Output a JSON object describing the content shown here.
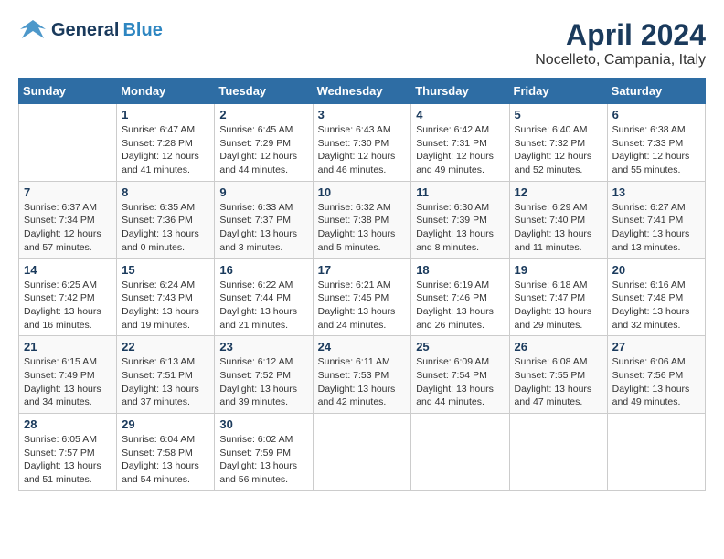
{
  "logo": {
    "text_general": "General",
    "text_blue": "Blue"
  },
  "title": "April 2024",
  "subtitle": "Nocelleto, Campania, Italy",
  "days_of_week": [
    "Sunday",
    "Monday",
    "Tuesday",
    "Wednesday",
    "Thursday",
    "Friday",
    "Saturday"
  ],
  "weeks": [
    [
      {
        "day": "",
        "sunrise": "",
        "sunset": "",
        "daylight": ""
      },
      {
        "day": "1",
        "sunrise": "Sunrise: 6:47 AM",
        "sunset": "Sunset: 7:28 PM",
        "daylight": "Daylight: 12 hours and 41 minutes."
      },
      {
        "day": "2",
        "sunrise": "Sunrise: 6:45 AM",
        "sunset": "Sunset: 7:29 PM",
        "daylight": "Daylight: 12 hours and 44 minutes."
      },
      {
        "day": "3",
        "sunrise": "Sunrise: 6:43 AM",
        "sunset": "Sunset: 7:30 PM",
        "daylight": "Daylight: 12 hours and 46 minutes."
      },
      {
        "day": "4",
        "sunrise": "Sunrise: 6:42 AM",
        "sunset": "Sunset: 7:31 PM",
        "daylight": "Daylight: 12 hours and 49 minutes."
      },
      {
        "day": "5",
        "sunrise": "Sunrise: 6:40 AM",
        "sunset": "Sunset: 7:32 PM",
        "daylight": "Daylight: 12 hours and 52 minutes."
      },
      {
        "day": "6",
        "sunrise": "Sunrise: 6:38 AM",
        "sunset": "Sunset: 7:33 PM",
        "daylight": "Daylight: 12 hours and 55 minutes."
      }
    ],
    [
      {
        "day": "7",
        "sunrise": "Sunrise: 6:37 AM",
        "sunset": "Sunset: 7:34 PM",
        "daylight": "Daylight: 12 hours and 57 minutes."
      },
      {
        "day": "8",
        "sunrise": "Sunrise: 6:35 AM",
        "sunset": "Sunset: 7:36 PM",
        "daylight": "Daylight: 13 hours and 0 minutes."
      },
      {
        "day": "9",
        "sunrise": "Sunrise: 6:33 AM",
        "sunset": "Sunset: 7:37 PM",
        "daylight": "Daylight: 13 hours and 3 minutes."
      },
      {
        "day": "10",
        "sunrise": "Sunrise: 6:32 AM",
        "sunset": "Sunset: 7:38 PM",
        "daylight": "Daylight: 13 hours and 5 minutes."
      },
      {
        "day": "11",
        "sunrise": "Sunrise: 6:30 AM",
        "sunset": "Sunset: 7:39 PM",
        "daylight": "Daylight: 13 hours and 8 minutes."
      },
      {
        "day": "12",
        "sunrise": "Sunrise: 6:29 AM",
        "sunset": "Sunset: 7:40 PM",
        "daylight": "Daylight: 13 hours and 11 minutes."
      },
      {
        "day": "13",
        "sunrise": "Sunrise: 6:27 AM",
        "sunset": "Sunset: 7:41 PM",
        "daylight": "Daylight: 13 hours and 13 minutes."
      }
    ],
    [
      {
        "day": "14",
        "sunrise": "Sunrise: 6:25 AM",
        "sunset": "Sunset: 7:42 PM",
        "daylight": "Daylight: 13 hours and 16 minutes."
      },
      {
        "day": "15",
        "sunrise": "Sunrise: 6:24 AM",
        "sunset": "Sunset: 7:43 PM",
        "daylight": "Daylight: 13 hours and 19 minutes."
      },
      {
        "day": "16",
        "sunrise": "Sunrise: 6:22 AM",
        "sunset": "Sunset: 7:44 PM",
        "daylight": "Daylight: 13 hours and 21 minutes."
      },
      {
        "day": "17",
        "sunrise": "Sunrise: 6:21 AM",
        "sunset": "Sunset: 7:45 PM",
        "daylight": "Daylight: 13 hours and 24 minutes."
      },
      {
        "day": "18",
        "sunrise": "Sunrise: 6:19 AM",
        "sunset": "Sunset: 7:46 PM",
        "daylight": "Daylight: 13 hours and 26 minutes."
      },
      {
        "day": "19",
        "sunrise": "Sunrise: 6:18 AM",
        "sunset": "Sunset: 7:47 PM",
        "daylight": "Daylight: 13 hours and 29 minutes."
      },
      {
        "day": "20",
        "sunrise": "Sunrise: 6:16 AM",
        "sunset": "Sunset: 7:48 PM",
        "daylight": "Daylight: 13 hours and 32 minutes."
      }
    ],
    [
      {
        "day": "21",
        "sunrise": "Sunrise: 6:15 AM",
        "sunset": "Sunset: 7:49 PM",
        "daylight": "Daylight: 13 hours and 34 minutes."
      },
      {
        "day": "22",
        "sunrise": "Sunrise: 6:13 AM",
        "sunset": "Sunset: 7:51 PM",
        "daylight": "Daylight: 13 hours and 37 minutes."
      },
      {
        "day": "23",
        "sunrise": "Sunrise: 6:12 AM",
        "sunset": "Sunset: 7:52 PM",
        "daylight": "Daylight: 13 hours and 39 minutes."
      },
      {
        "day": "24",
        "sunrise": "Sunrise: 6:11 AM",
        "sunset": "Sunset: 7:53 PM",
        "daylight": "Daylight: 13 hours and 42 minutes."
      },
      {
        "day": "25",
        "sunrise": "Sunrise: 6:09 AM",
        "sunset": "Sunset: 7:54 PM",
        "daylight": "Daylight: 13 hours and 44 minutes."
      },
      {
        "day": "26",
        "sunrise": "Sunrise: 6:08 AM",
        "sunset": "Sunset: 7:55 PM",
        "daylight": "Daylight: 13 hours and 47 minutes."
      },
      {
        "day": "27",
        "sunrise": "Sunrise: 6:06 AM",
        "sunset": "Sunset: 7:56 PM",
        "daylight": "Daylight: 13 hours and 49 minutes."
      }
    ],
    [
      {
        "day": "28",
        "sunrise": "Sunrise: 6:05 AM",
        "sunset": "Sunset: 7:57 PM",
        "daylight": "Daylight: 13 hours and 51 minutes."
      },
      {
        "day": "29",
        "sunrise": "Sunrise: 6:04 AM",
        "sunset": "Sunset: 7:58 PM",
        "daylight": "Daylight: 13 hours and 54 minutes."
      },
      {
        "day": "30",
        "sunrise": "Sunrise: 6:02 AM",
        "sunset": "Sunset: 7:59 PM",
        "daylight": "Daylight: 13 hours and 56 minutes."
      },
      {
        "day": "",
        "sunrise": "",
        "sunset": "",
        "daylight": ""
      },
      {
        "day": "",
        "sunrise": "",
        "sunset": "",
        "daylight": ""
      },
      {
        "day": "",
        "sunrise": "",
        "sunset": "",
        "daylight": ""
      },
      {
        "day": "",
        "sunrise": "",
        "sunset": "",
        "daylight": ""
      }
    ]
  ]
}
